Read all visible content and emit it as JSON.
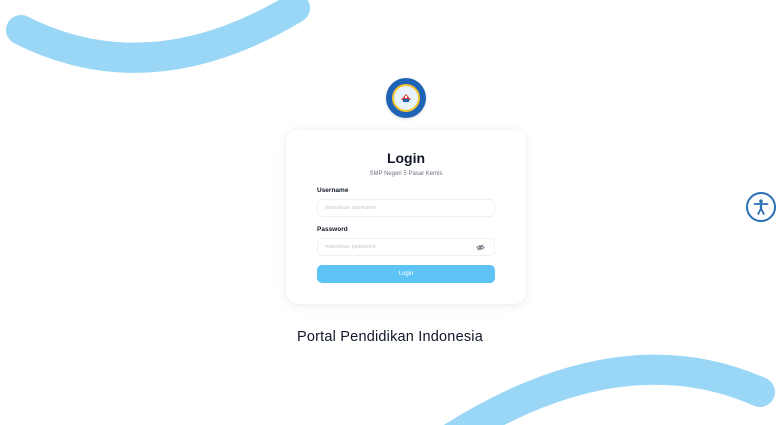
{
  "login": {
    "title": "Login",
    "subtitle": "SMP Negeri 5 Pasar Kemis",
    "username_label": "Username",
    "username_placeholder": "masukkan username",
    "password_label": "Password",
    "password_placeholder": "masukkan password",
    "button_label": "Login"
  },
  "footer": {
    "tagline": "Portal Pendidikan Indonesia"
  },
  "icons": {
    "logo": "school-logo-icon",
    "toggle_password": "eye-off-icon",
    "accessibility": "accessibility-icon"
  },
  "colors": {
    "accent": "#5ec3f5",
    "decoration": "#9ad6f6",
    "accessibility": "#2a6fb3",
    "logo": "#1e63b6"
  }
}
